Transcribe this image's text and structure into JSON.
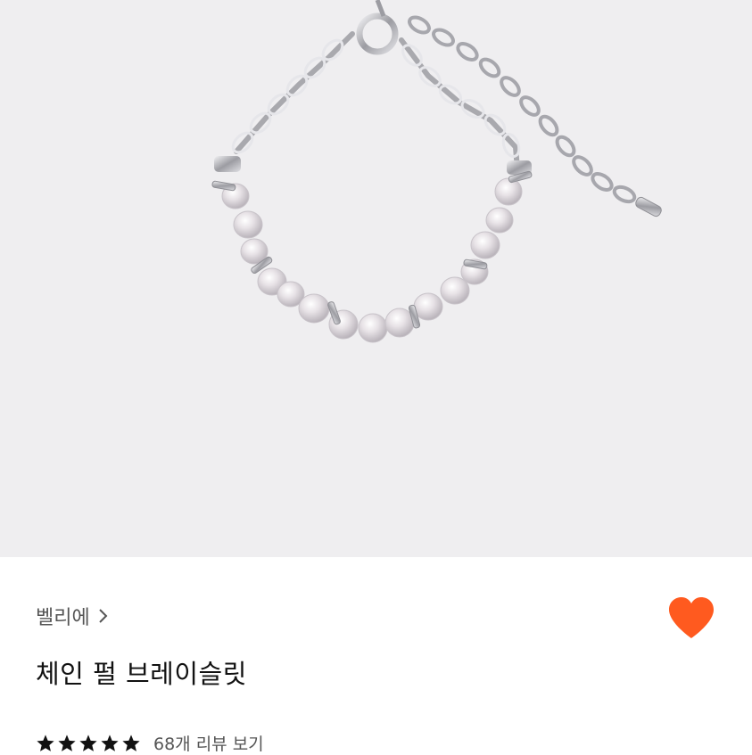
{
  "product": {
    "brand": "벨리에",
    "title": "체인 펄 브레이슬릿",
    "rating_stars": 5,
    "review_link": "68개 리뷰 보기",
    "favorited": true
  },
  "icons": {
    "brand_chevron": "chevron-right-icon",
    "favorite": "heart-icon",
    "star": "star-icon"
  },
  "colors": {
    "image_background": "#efeef0",
    "heart": "#ff5a1f",
    "star": "#111111",
    "brand_text": "#555555",
    "title_text": "#111111"
  }
}
